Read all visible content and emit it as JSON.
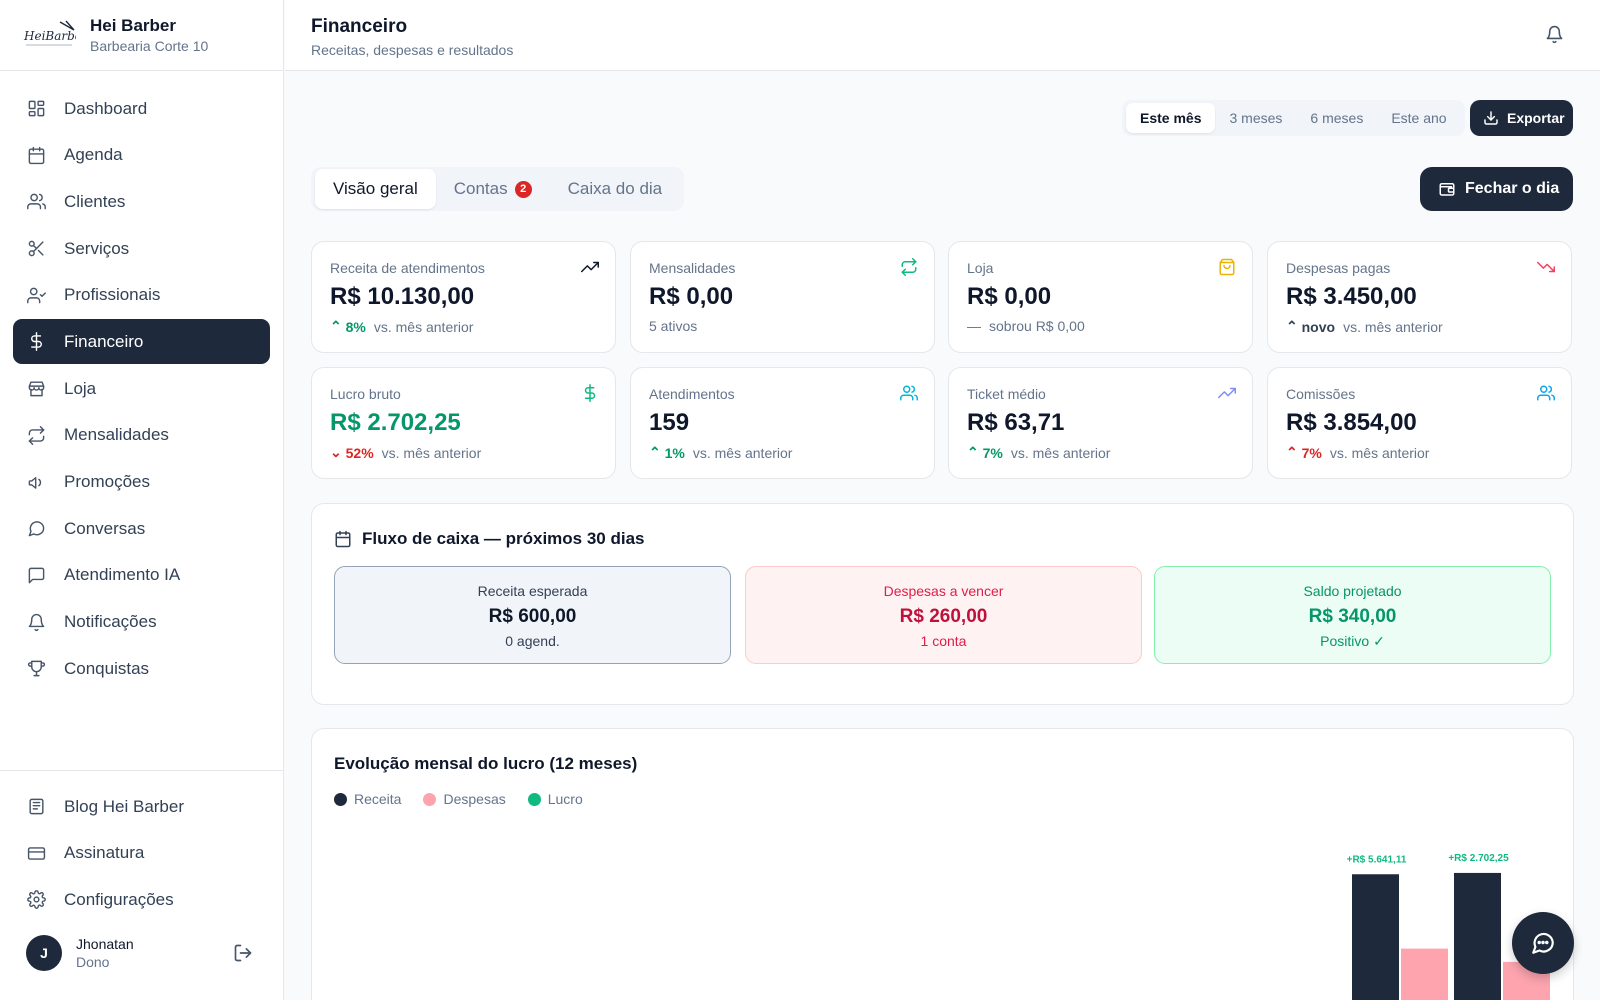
{
  "brand": {
    "name": "Hei Barber",
    "subtitle": "Barbearia Corte 10"
  },
  "nav": [
    {
      "label": "Dashboard",
      "icon": "dashboard-icon"
    },
    {
      "label": "Agenda",
      "icon": "calendar-icon"
    },
    {
      "label": "Clientes",
      "icon": "users-icon"
    },
    {
      "label": "Serviços",
      "icon": "scissors-icon"
    },
    {
      "label": "Profissionais",
      "icon": "user-check-icon"
    },
    {
      "label": "Financeiro",
      "icon": "dollar-icon",
      "active": true
    },
    {
      "label": "Loja",
      "icon": "store-icon"
    },
    {
      "label": "Mensalidades",
      "icon": "repeat-icon"
    },
    {
      "label": "Promoções",
      "icon": "megaphone-icon"
    },
    {
      "label": "Conversas",
      "icon": "chat-bubble-icon"
    },
    {
      "label": "Atendimento IA",
      "icon": "message-square-icon"
    },
    {
      "label": "Notificações",
      "icon": "bell-icon"
    },
    {
      "label": "Conquistas",
      "icon": "trophy-icon"
    }
  ],
  "nav_bottom": [
    {
      "label": "Blog Hei Barber",
      "icon": "newspaper-icon"
    },
    {
      "label": "Assinatura",
      "icon": "credit-card-icon"
    },
    {
      "label": "Configurações",
      "icon": "gear-icon"
    }
  ],
  "user": {
    "initial": "J",
    "name": "Jhonatan",
    "role": "Dono"
  },
  "header": {
    "title": "Financeiro",
    "subtitle": "Receitas, despesas e resultados"
  },
  "period": {
    "options": [
      "Este mês",
      "3 meses",
      "6 meses",
      "Este ano"
    ],
    "selected": "Este mês"
  },
  "actions": {
    "export_label": "Exportar",
    "close_day_label": "Fechar o dia"
  },
  "tabs": [
    {
      "label": "Visão geral",
      "selected": true
    },
    {
      "label": "Contas",
      "badge": "2"
    },
    {
      "label": "Caixa do dia"
    }
  ],
  "cards": [
    {
      "label": "Receita de atendimentos",
      "value": "R$ 10.130,00",
      "trend": "8%",
      "trend_dir": "up",
      "note": "vs. mês anterior",
      "icon": "trending-up-icon",
      "icon_color": "#0f172a"
    },
    {
      "label": "Mensalidades",
      "value": "R$ 0,00",
      "trend": "",
      "trend_dir": "none",
      "note": "5 ativos",
      "icon": "repeat-icon",
      "icon_color": "#10b981"
    },
    {
      "label": "Loja",
      "value": "R$ 0,00",
      "trend": "—",
      "trend_dir": "dash",
      "note": "sobrou R$ 0,00",
      "icon": "shopping-bag-icon",
      "icon_color": "#eab308"
    },
    {
      "label": "Despesas pagas",
      "value": "R$ 3.450,00",
      "trend": "novo",
      "trend_dir": "neutral",
      "note": "vs. mês anterior",
      "icon": "trending-down-icon",
      "icon_color": "#f43f5e"
    },
    {
      "label": "Lucro bruto",
      "value": "R$ 2.702,25",
      "value_color": "green",
      "trend": "52%",
      "trend_dir": "down",
      "note": "vs. mês anterior",
      "icon": "dollar-icon",
      "icon_color": "#10b981"
    },
    {
      "label": "Atendimentos",
      "value": "159",
      "trend": "1%",
      "trend_dir": "up",
      "note": "vs. mês anterior",
      "icon": "users-icon",
      "icon_color": "#06b6d4"
    },
    {
      "label": "Ticket médio",
      "value": "R$ 63,71",
      "trend": "7%",
      "trend_dir": "up",
      "note": "vs. mês anterior",
      "icon": "trending-up-icon",
      "icon_color": "#818cf8"
    },
    {
      "label": "Comissões",
      "value": "R$ 3.854,00",
      "trend": "7%",
      "trend_dir": "up-red",
      "note": "vs. mês anterior",
      "icon": "users-icon",
      "icon_color": "#0ea5e9"
    }
  ],
  "cashflow": {
    "title": "Fluxo de caixa — próximos 30 dias",
    "boxes": [
      {
        "label": "Receita esperada",
        "value": "R$ 600,00",
        "sub": "0 agend."
      },
      {
        "label": "Despesas a vencer",
        "value": "R$ 260,00",
        "sub": "1 conta"
      },
      {
        "label": "Saldo projetado",
        "value": "R$ 340,00",
        "sub": "Positivo ✓"
      }
    ]
  },
  "chart": {
    "title": "Evolução mensal do lucro (12 meses)",
    "colors": {
      "receita": "#1e293b",
      "despesas": "#fda4af",
      "lucro": "#10b981"
    }
  },
  "chart_data": {
    "type": "bar",
    "title": "Evolução mensal do lucro (12 meses)",
    "series": [
      {
        "name": "Receita",
        "values": [
          10.9,
          11.0
        ]
      },
      {
        "name": "Despesas",
        "values": [
          5.3,
          4.3
        ]
      },
      {
        "name": "Lucro",
        "values": [
          5641.11,
          2702.25
        ]
      }
    ],
    "data_labels": [
      "+R$ 5.641,11",
      "+R$ 2.702,25"
    ],
    "visible_max": 12.2
  }
}
